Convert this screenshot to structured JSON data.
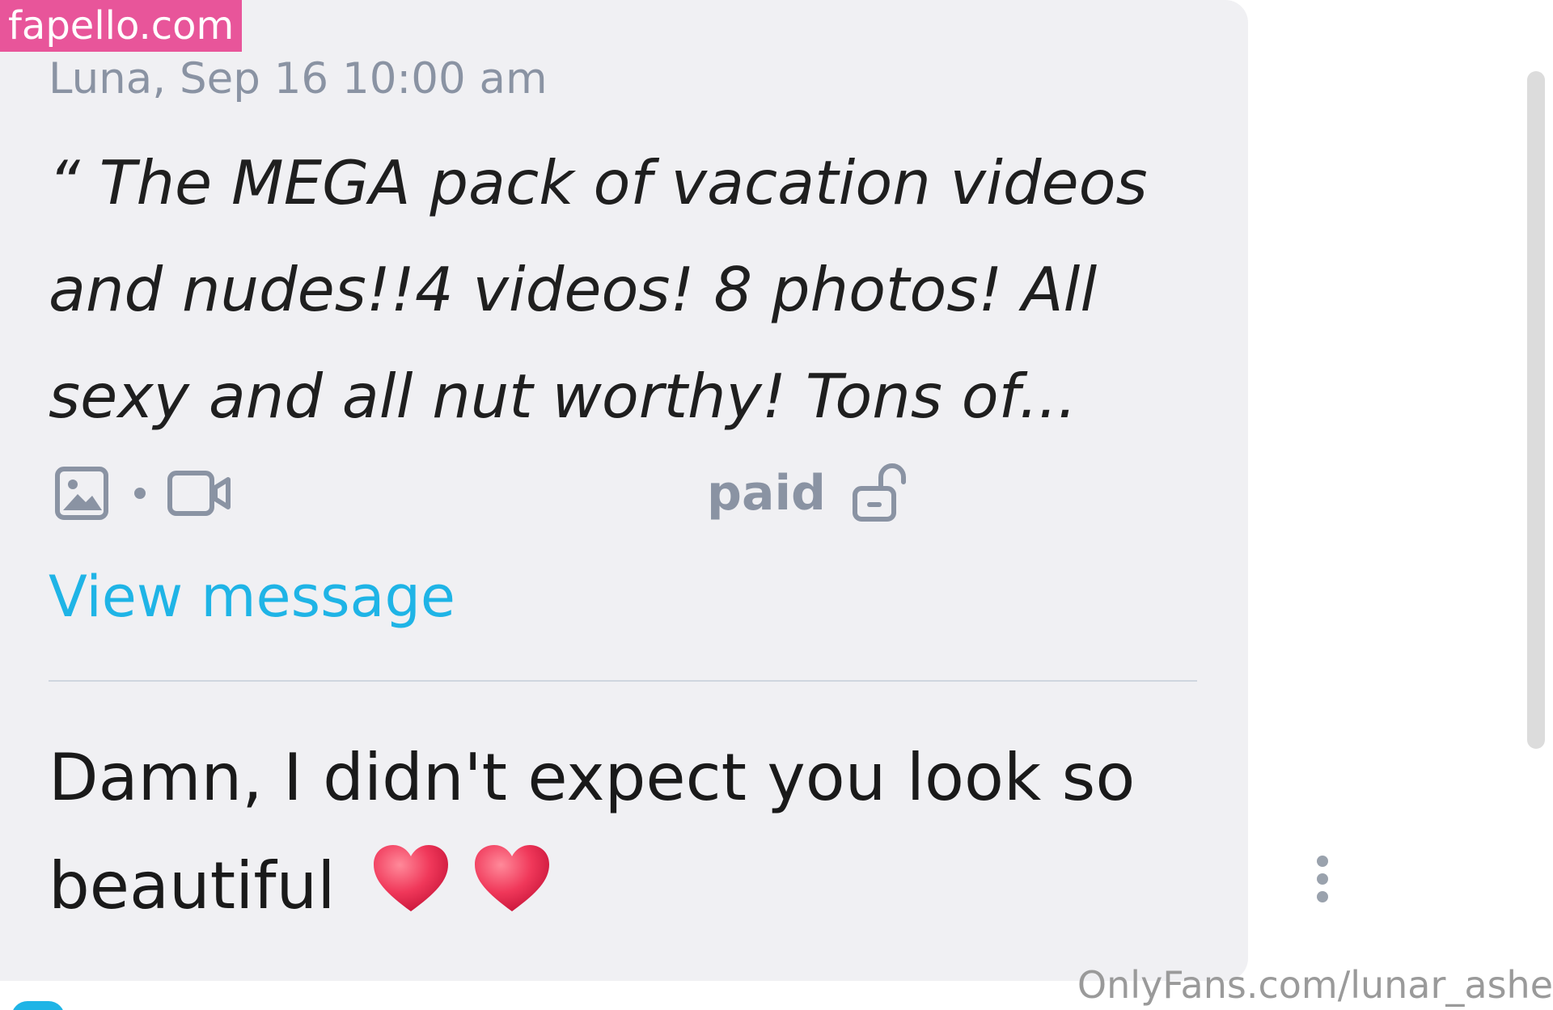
{
  "watermark_top": "fapello.com",
  "message": {
    "meta": "Luna, Sep 16 10:00 am",
    "quote": "“ The MEGA pack of vacation videos and nudes!!4 videos! 8 photos! All sexy and all nut worthy! Tons of...",
    "media_icons": [
      "image-icon",
      "video-icon"
    ],
    "status_label": "paid",
    "status_icon": "unlock-icon",
    "view_link": "View message"
  },
  "reply": {
    "text": "Damn, I didn't expect you look so beautiful",
    "emoji": [
      "red-heart-icon",
      "red-heart-icon"
    ]
  },
  "watermark_bottom": "OnlyFans.com/lunar_ashe",
  "colors": {
    "bubble_bg": "#f0f0f3",
    "accent_link": "#1fb4e6",
    "muted": "#8a93a3",
    "heart": "#f0385a",
    "watermark_pink": "#e8559a"
  }
}
